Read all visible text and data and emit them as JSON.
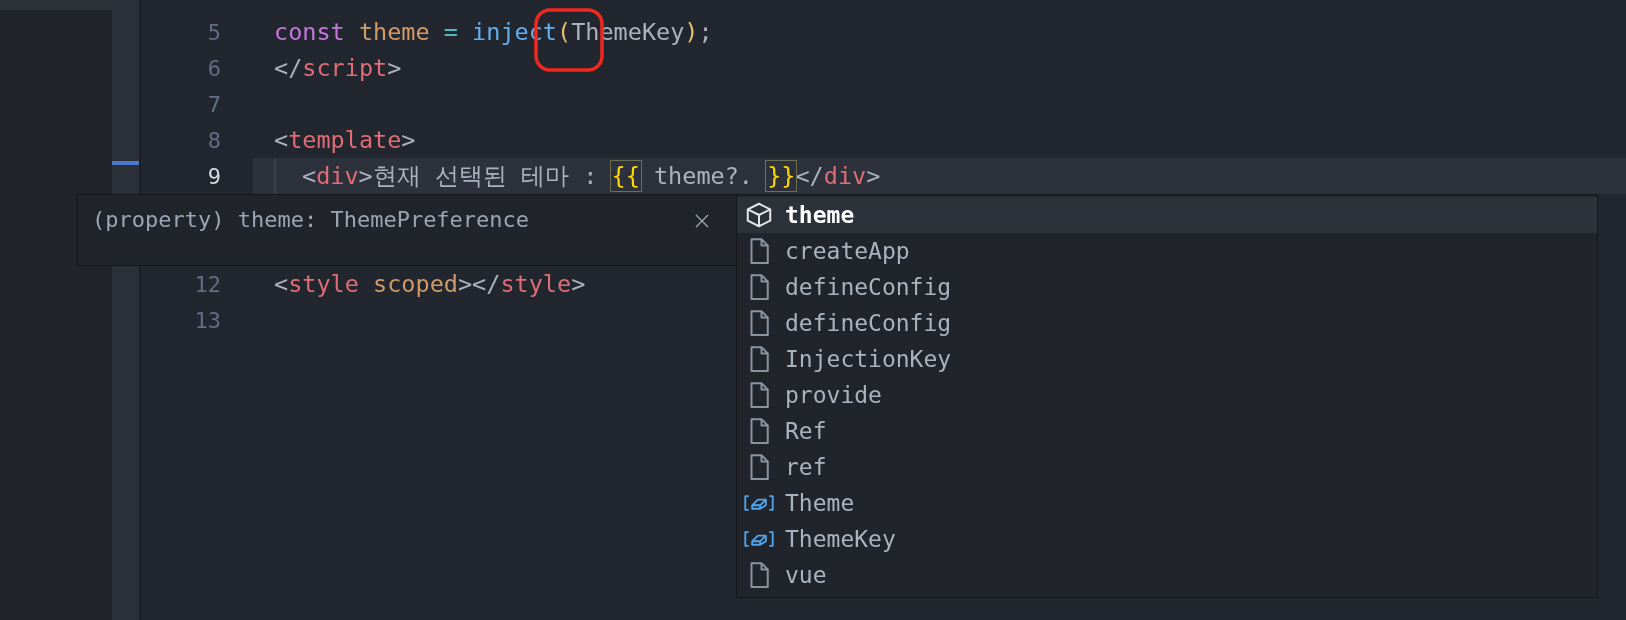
{
  "editor": {
    "lines": [
      {
        "number": "5",
        "current": false,
        "tokens": [
          {
            "text": "const ",
            "kind": "keyword"
          },
          {
            "text": "theme",
            "kind": "variable"
          },
          {
            "text": " = ",
            "kind": "operator"
          },
          {
            "text": "inject",
            "kind": "function"
          },
          {
            "text": "(",
            "kind": "paren"
          },
          {
            "text": "ThemeKey",
            "kind": "plain"
          },
          {
            "text": ")",
            "kind": "paren"
          },
          {
            "text": ";",
            "kind": "plain"
          }
        ]
      },
      {
        "number": "6",
        "current": false,
        "tokens": [
          {
            "text": "</",
            "kind": "plain"
          },
          {
            "text": "script",
            "kind": "tag"
          },
          {
            "text": ">",
            "kind": "plain"
          }
        ]
      },
      {
        "number": "7",
        "current": false
      },
      {
        "number": "8",
        "current": false,
        "tokens": [
          {
            "text": "<",
            "kind": "plain"
          },
          {
            "text": "template",
            "kind": "tag"
          },
          {
            "text": ">",
            "kind": "plain"
          }
        ]
      },
      {
        "number": "9",
        "current": true,
        "indent": true,
        "tokens": [
          {
            "text": "<",
            "kind": "plain"
          },
          {
            "text": "div",
            "kind": "tag"
          },
          {
            "text": ">",
            "kind": "plain"
          },
          {
            "text": "현재 선택된 테마 : ",
            "kind": "plain"
          },
          {
            "text": "{{",
            "kind": "brace"
          },
          {
            "text": " theme?. ",
            "kind": "plain"
          },
          {
            "text": "}}",
            "kind": "brace"
          },
          {
            "text": "</",
            "kind": "plain"
          },
          {
            "text": "div",
            "kind": "tag"
          },
          {
            "text": ">",
            "kind": "plain"
          }
        ]
      },
      {
        "number": "12",
        "current": false,
        "tokens": [
          {
            "text": "<",
            "kind": "plain"
          },
          {
            "text": "style",
            "kind": "tag"
          },
          {
            "text": " scoped",
            "kind": "variable"
          },
          {
            "text": "></",
            "kind": "plain"
          },
          {
            "text": "style",
            "kind": "tag"
          },
          {
            "text": ">",
            "kind": "plain"
          }
        ]
      },
      {
        "number": "13",
        "current": false
      }
    ]
  },
  "hover": {
    "text": "(property) theme: ThemePreference"
  },
  "suggestions": [
    {
      "label": "theme",
      "kind": "property",
      "selected": true
    },
    {
      "label": "createApp",
      "kind": "file",
      "selected": false
    },
    {
      "label": "defineConfig",
      "kind": "file",
      "selected": false
    },
    {
      "label": "defineConfig",
      "kind": "file",
      "selected": false
    },
    {
      "label": "InjectionKey",
      "kind": "file",
      "selected": false
    },
    {
      "label": "provide",
      "kind": "file",
      "selected": false
    },
    {
      "label": "Ref",
      "kind": "file",
      "selected": false
    },
    {
      "label": "ref",
      "kind": "file",
      "selected": false
    },
    {
      "label": "Theme",
      "kind": "variable",
      "selected": false
    },
    {
      "label": "ThemeKey",
      "kind": "variable",
      "selected": false
    },
    {
      "label": "vue",
      "kind": "file",
      "selected": false
    }
  ]
}
